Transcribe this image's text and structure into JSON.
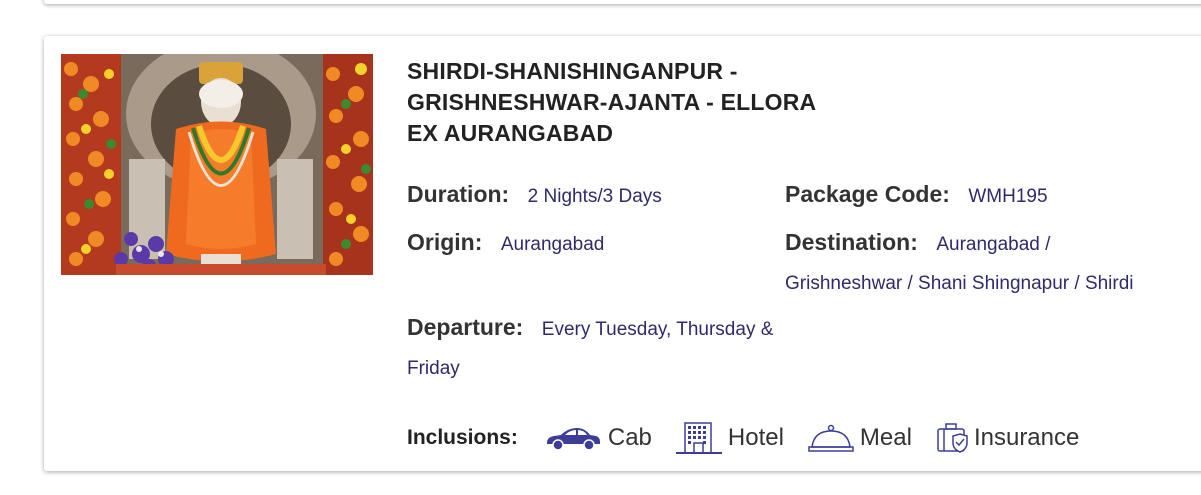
{
  "package": {
    "title": "SHIRDI-SHANISHINGANPUR - GRISHNESHWAR-AJANTA - ELLORA EX AURANGABAD",
    "duration_label": "Duration:",
    "duration_value": "2 Nights/3 Days",
    "code_label": "Package Code:",
    "code_value": "WMH195",
    "origin_label": "Origin:",
    "origin_value": "Aurangabad",
    "destination_label": "Destination:",
    "destination_value": "Aurangabad / Grishneshwar / Shani Shingnapur / Shirdi",
    "departure_label": "Departure:",
    "departure_value": "Every Tuesday, Thursday & Friday",
    "inclusions_label": "Inclusions:",
    "inclusions": [
      {
        "label": "Cab",
        "icon": "car-icon"
      },
      {
        "label": "Hotel",
        "icon": "hotel-icon"
      },
      {
        "label": "Meal",
        "icon": "meal-cloche-icon"
      },
      {
        "label": "Insurance",
        "icon": "insurance-luggage-icon"
      }
    ]
  },
  "colors": {
    "value_text": "#2f2a6b",
    "icon": "#3d3d99"
  }
}
